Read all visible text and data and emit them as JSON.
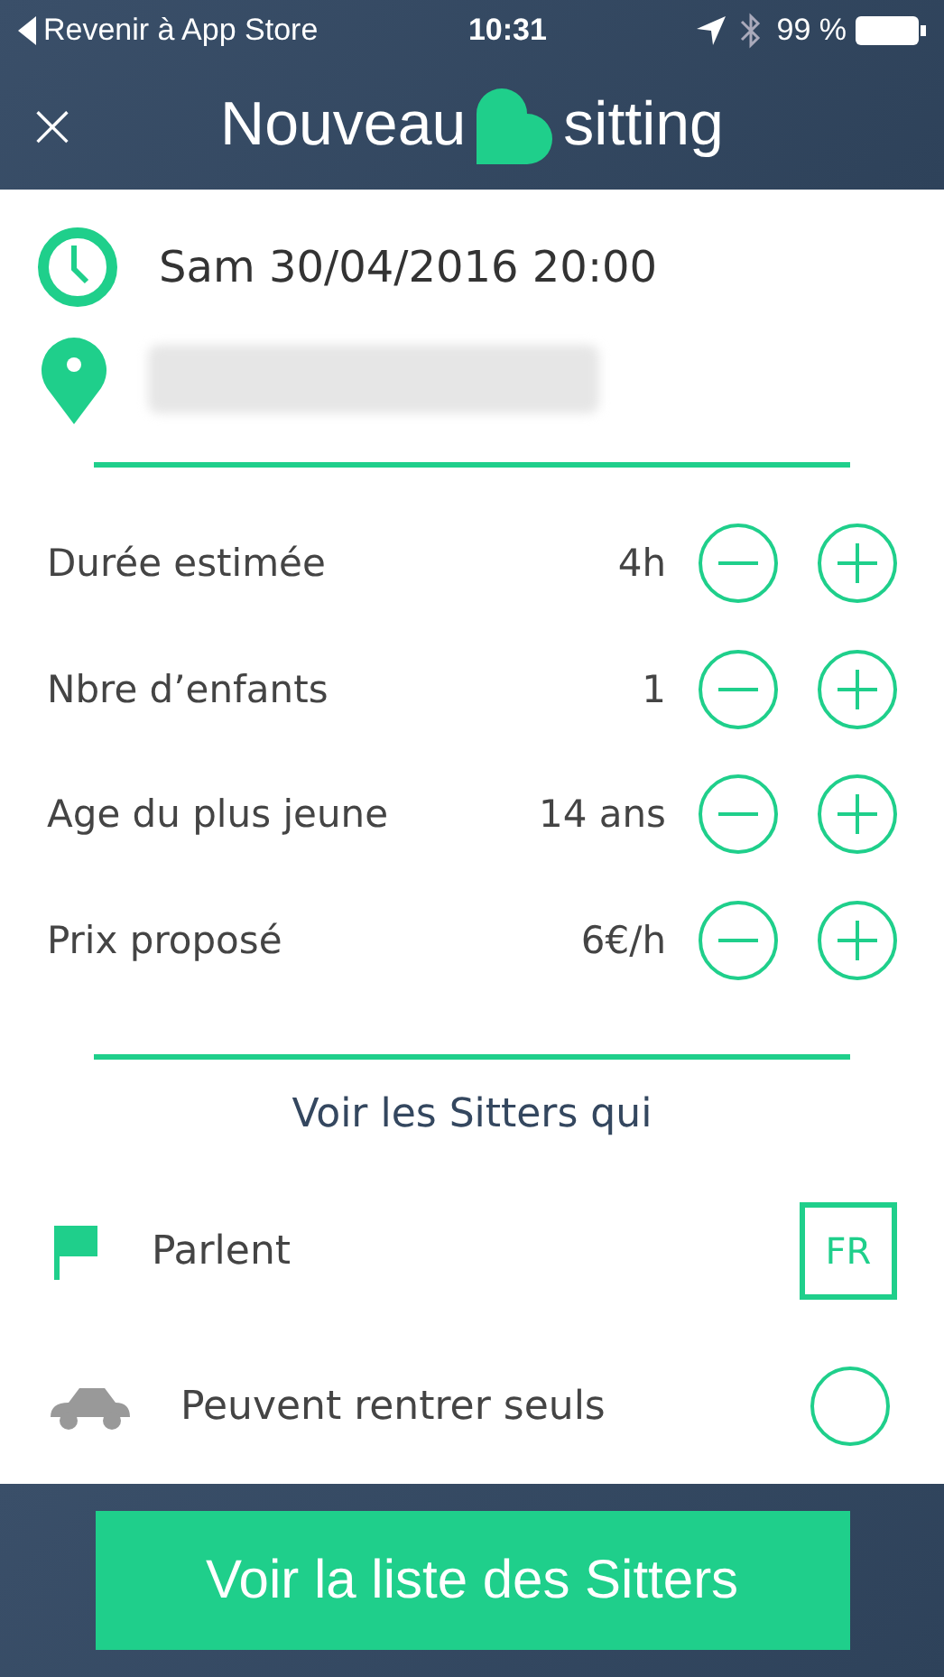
{
  "status_bar": {
    "back": "Revenir à App Store",
    "time": "10:31",
    "battery": "99 %"
  },
  "header": {
    "close": "×",
    "title_before": "Nouveau",
    "title_after": "sitting"
  },
  "datetime": "Sam 30/04/2016 20:00",
  "location": {
    "blurred": true
  },
  "steppers": [
    {
      "label": "Durée estimée",
      "value": "4h"
    },
    {
      "label": "Nbre d’enfants",
      "value": "1"
    },
    {
      "label": "Age du plus jeune",
      "value": "14 ans"
    },
    {
      "label": "Prix proposé",
      "value": "6€/h"
    }
  ],
  "filters_title": "Voir les Sitters qui",
  "filters": [
    {
      "kind": "language",
      "label": "Parlent",
      "value": "FR"
    },
    {
      "kind": "toggle",
      "label": "Peuvent rentrer seuls",
      "checked": false
    }
  ],
  "footer_button": "Voir la liste des Sitters"
}
